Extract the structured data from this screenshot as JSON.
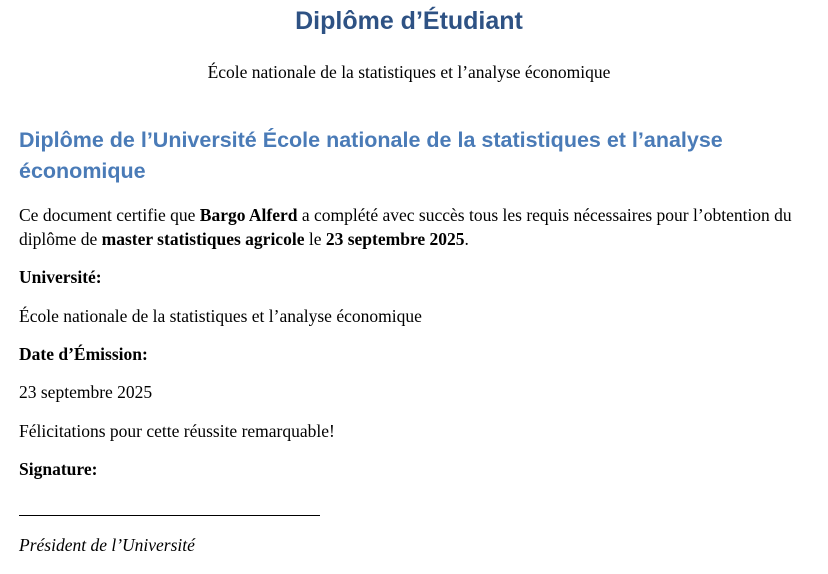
{
  "document": {
    "title": "Diplôme d’Étudiant",
    "subtitle": "École nationale de la statistiques et l’analyse économique",
    "heading": "Diplôme de l’Université École nationale de la statistiques et l’analyse économique",
    "certify": {
      "part1": "Ce document certifie que ",
      "student_name": "Bargo Alferd",
      "part2": " a complété avec succès tous les requis nécessaires pour l’obtention du diplôme de ",
      "degree": "master statistiques agricole",
      "part3": " le ",
      "date": "23 septembre 2025",
      "part4": "."
    },
    "university_label": "Université:",
    "university_value": "École nationale de la statistiques et l’analyse économique",
    "date_label": "Date d’Émission:",
    "date_value": "23 septembre 2025",
    "congratulations": "Félicitations pour cette réussite remarquable!",
    "signature_label": "Signature:",
    "signatory": "Président de l’Université"
  },
  "colors": {
    "title": "#2e5284",
    "heading": "#4a7bb7",
    "text": "#000000"
  }
}
